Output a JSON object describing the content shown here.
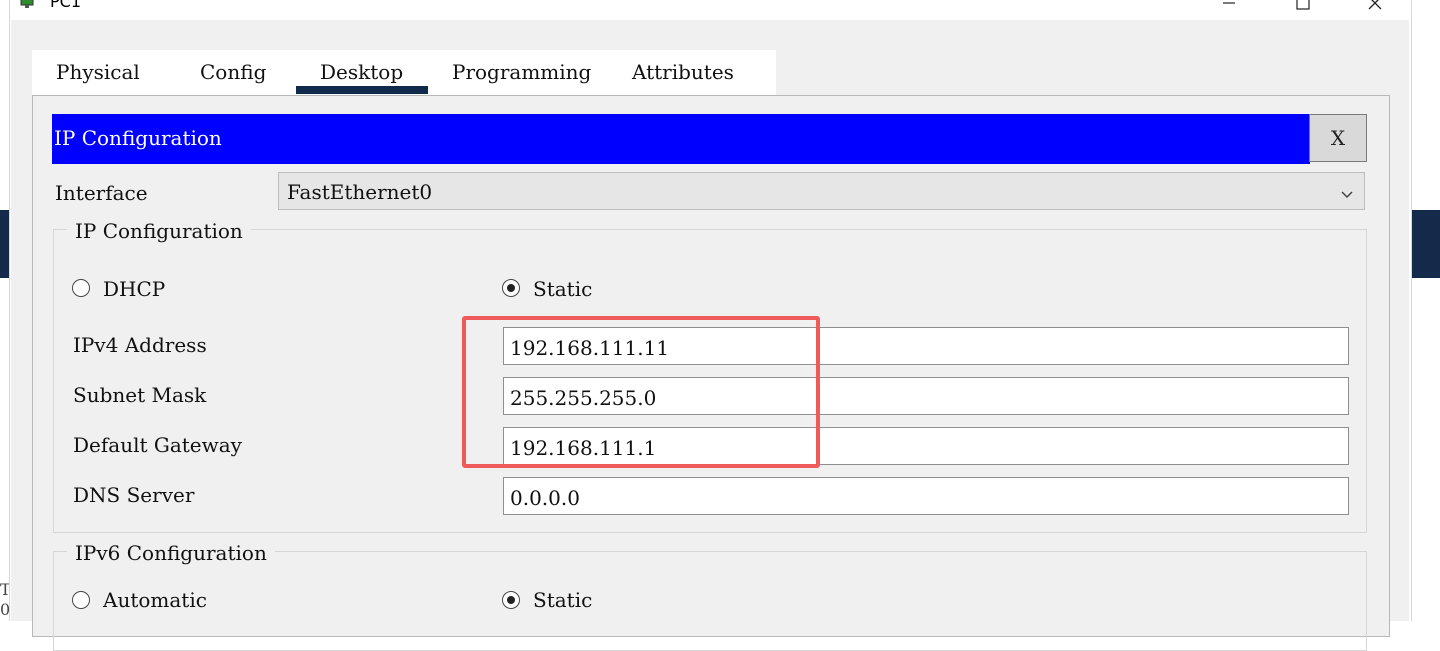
{
  "window": {
    "title": "PC1"
  },
  "tabs": [
    {
      "label": "Physical"
    },
    {
      "label": "Config"
    },
    {
      "label": "Desktop"
    },
    {
      "label": "Programming"
    },
    {
      "label": "Attributes"
    }
  ],
  "active_tab": "Desktop",
  "ip_config": {
    "header_title": "IP Configuration",
    "close_label": "X",
    "interface_label": "Interface",
    "interface_value": "FastEthernet0",
    "ipv4_group_title": "IP Configuration",
    "dhcp_label": "DHCP",
    "static_label": "Static",
    "ipv4_mode": "Static",
    "fields": {
      "ipv4_label": "IPv4 Address",
      "ipv4_value": "192.168.111.11",
      "subnet_label": "Subnet Mask",
      "subnet_value": "255.255.255.0",
      "gateway_label": "Default Gateway",
      "gateway_value": "192.168.111.1",
      "dns_label": "DNS Server",
      "dns_value": "0.0.0.0"
    },
    "ipv6_group_title": "IPv6 Configuration",
    "automatic_label": "Automatic",
    "ipv6_static_label": "Static",
    "ipv6_mode": "Static"
  },
  "background_fragments": [
    "T",
    "0"
  ],
  "colors": {
    "header_blue": "#0000FE",
    "tab_underline": "#0F2A4A",
    "highlight_red": "#EF5A5A",
    "client_bg": "#F0F0F0"
  },
  "icons": [
    "app-icon",
    "minimize-icon",
    "maximize-icon",
    "close-icon",
    "chevron-down-icon"
  ]
}
